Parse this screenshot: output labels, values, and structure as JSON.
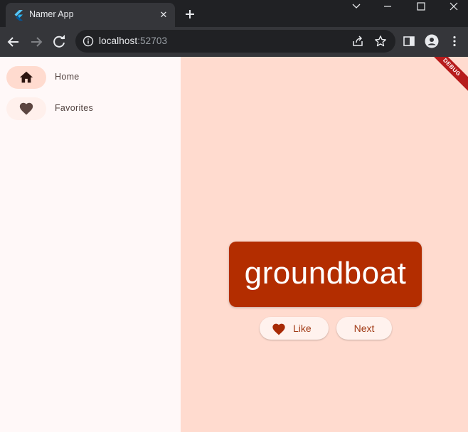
{
  "browser": {
    "tab": {
      "title": "Namer App",
      "close_glyph": "✕"
    },
    "omnibox": {
      "host": "localhost",
      "port": ":52703"
    }
  },
  "app": {
    "rail": {
      "items": [
        {
          "label": "Home",
          "icon": "home-icon",
          "selected": true
        },
        {
          "label": "Favorites",
          "icon": "favorite-icon",
          "selected": false
        }
      ]
    },
    "word": "groundboat",
    "like_label": "Like",
    "next_label": "Next",
    "debug_banner": "DEBUG"
  },
  "colors": {
    "page_background": "#ffdbcf",
    "rail_background": "#fff8f8",
    "card": "#b32d00",
    "selected_indicator": "#ffdbcf",
    "button_text": "#a13a15"
  }
}
